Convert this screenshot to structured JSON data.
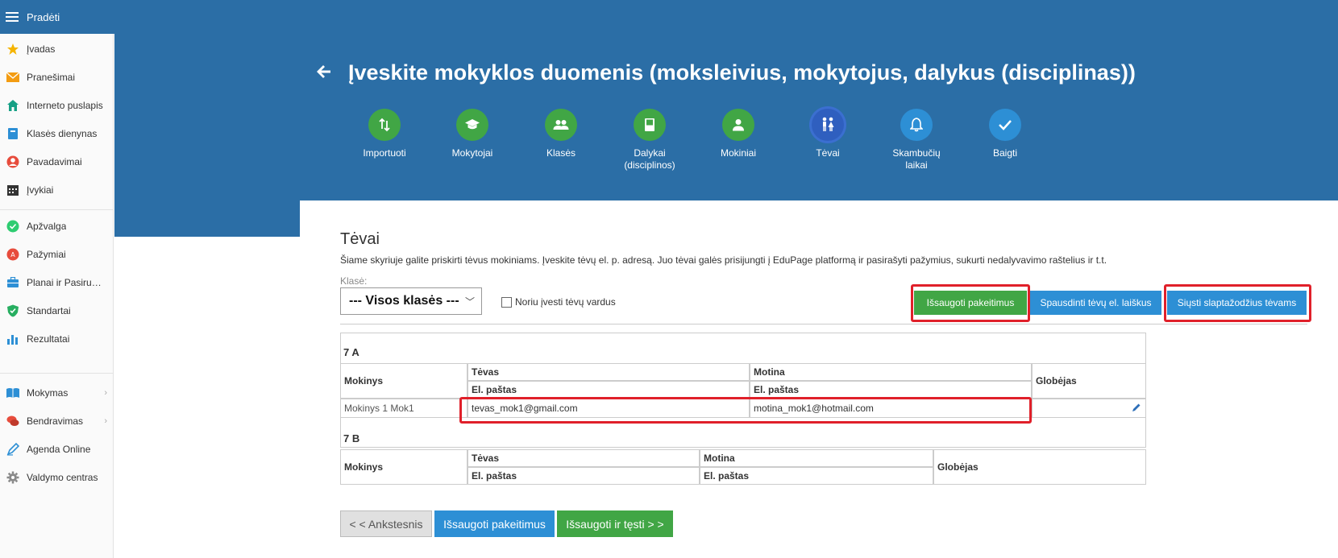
{
  "topbar": {
    "title": "Pradėti"
  },
  "sidebar": {
    "items": [
      {
        "label": "Įvadas",
        "icon": "star-icon",
        "color": "#f5b400"
      },
      {
        "label": "Pranešimai",
        "icon": "envelope-icon",
        "color": "#f39c12"
      },
      {
        "label": "Interneto puslapis",
        "icon": "home-icon",
        "color": "#16a085"
      },
      {
        "label": "Klasės dienynas",
        "icon": "book-icon",
        "color": "#2d8fd5"
      },
      {
        "label": "Pavadavimai",
        "icon": "person-icon",
        "color": "#e74c3c"
      },
      {
        "label": "Įvykiai",
        "icon": "calendar-icon",
        "color": "#333333"
      },
      {
        "label": "Apžvalga",
        "icon": "check-circle-icon",
        "color": "#2ecc71"
      },
      {
        "label": "Pažymiai",
        "icon": "grade-icon",
        "color": "#e74c3c"
      },
      {
        "label": "Planai ir Pasiruošimas",
        "icon": "briefcase-icon",
        "color": "#2d8fd5"
      },
      {
        "label": "Standartai",
        "icon": "shield-check-icon",
        "color": "#27ae60"
      },
      {
        "label": "Rezultatai",
        "icon": "bar-chart-icon",
        "color": "#2d8fd5"
      },
      {
        "label": "Mokymas",
        "icon": "open-book-icon",
        "color": "#2d8fd5"
      },
      {
        "label": "Bendravimas",
        "icon": "chat-icon",
        "color": "#e74c3c"
      },
      {
        "label": "Agenda Online",
        "icon": "pen-icon",
        "color": "#2d8fd5"
      },
      {
        "label": "Valdymo centras",
        "icon": "gear-icon",
        "color": "#888888"
      }
    ]
  },
  "header": {
    "title": "Įveskite mokyklos duomenis (moksleivius, mokytojus, dalykus (disciplinas))",
    "steps": [
      {
        "label": "Importuoti",
        "icon": "import-arrows-icon",
        "color": "#41a645"
      },
      {
        "label": "Mokytojai",
        "icon": "graduation-cap-icon",
        "color": "#41a645"
      },
      {
        "label": "Klasės",
        "icon": "group-icon",
        "color": "#41a645"
      },
      {
        "label": "Dalykai\n(disciplinos)",
        "icon": "book-icon",
        "color": "#41a645"
      },
      {
        "label": "Mokiniai",
        "icon": "person-icon",
        "color": "#41a645"
      },
      {
        "label": "Tėvai",
        "icon": "parents-icon",
        "color": "#2f5fbf",
        "active": true
      },
      {
        "label": "Skambučių\nlaikai",
        "icon": "bell-icon",
        "color": "#2d8fd5"
      },
      {
        "label": "Baigti",
        "icon": "checkmark-icon",
        "color": "#2d8fd5"
      }
    ]
  },
  "main": {
    "title": "Tėvai",
    "description": "Šiame skyriuje galite priskirti tėvus mokiniams. Įveskite tėvų el. p. adresą. Juo tėvai galės prisijungti į EduPage platformą ir pasirašyti pažymius, sukurti nedalyvavimo raštelius ir t.t.",
    "class_label": "Klasė:",
    "class_select": "--- Visos klasės ---",
    "checkbox_label": "Noriu įvesti tėvų vardus",
    "buttons": {
      "save": "Išsaugoti pakeitimus",
      "print": "Spausdinti tėvų el. laiškus",
      "send": "Siųsti slaptažodžius tėvams"
    },
    "tables": [
      {
        "class": "7 A",
        "headers": {
          "student": "Mokinys",
          "father": "Tėvas",
          "mother": "Motina",
          "email": "El. paštas",
          "guardian": "Globėjas"
        },
        "rows": [
          {
            "student": "Mokinys 1 Mok1",
            "father_email": "tevas_mok1@gmail.com",
            "mother_email": "motina_mok1@hotmail.com"
          }
        ]
      },
      {
        "class": "7 B",
        "headers": {
          "student": "Mokinys",
          "father": "Tėvas",
          "mother": "Motina",
          "email": "El. paštas",
          "guardian": "Globėjas"
        },
        "rows": []
      }
    ],
    "bottom_buttons": {
      "prev": "< < Ankstesnis",
      "save": "Išsaugoti pakeitimus",
      "save_continue": "Išsaugoti ir tęsti > >"
    }
  }
}
